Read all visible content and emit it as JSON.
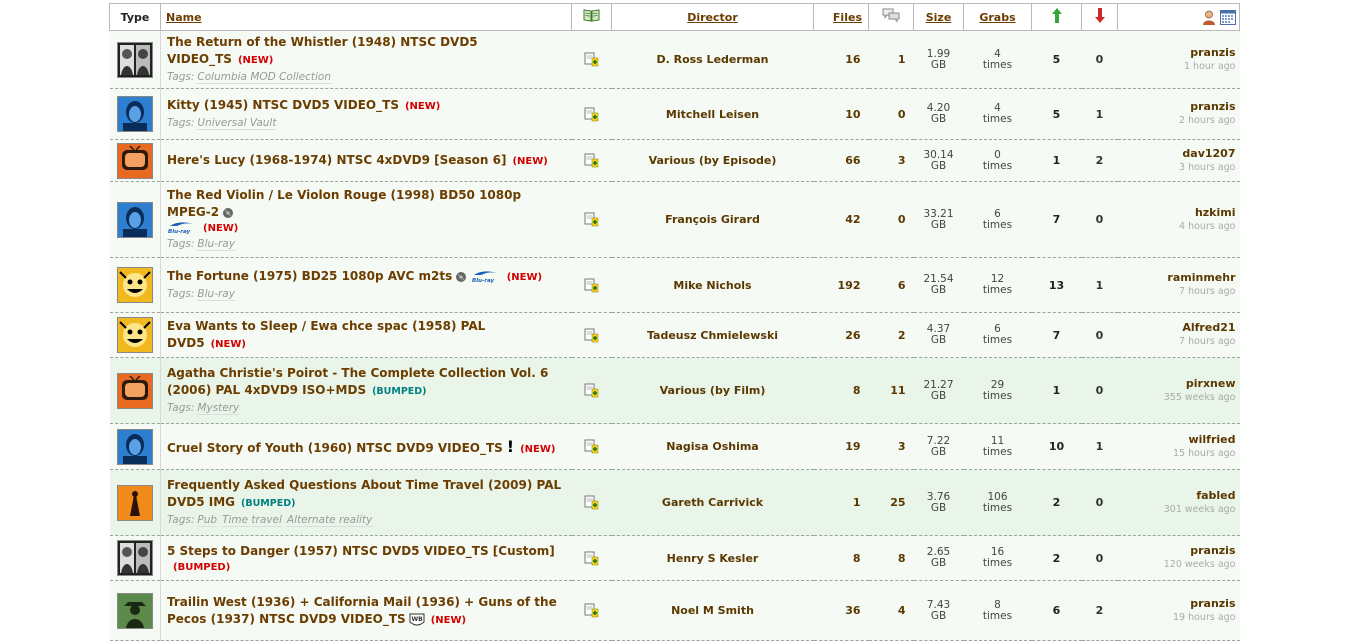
{
  "headers": {
    "type": "Type",
    "name": "Name",
    "director": "Director",
    "files": "Files",
    "size": "Size",
    "grabs": "Grabs"
  },
  "icons": {
    "book": "book-icon",
    "comments": "comments-icon",
    "seeders": "green-up-arrow-icon",
    "leechers": "red-down-arrow-icon",
    "uploader": "user-icon",
    "date": "calendar-icon",
    "add": "add-bookmark-icon"
  },
  "colors": {
    "link": "#6b3d00",
    "new": "#d40000",
    "bumped": "#008080",
    "row_bg": "#f5faf5",
    "bumped_row_bg": "#e9f5e9"
  },
  "rows": [
    {
      "title": "The Return of the Whistler (1948) NTSC DVD5 VIDEO_TS",
      "badge": "(NEW)",
      "tagsLabel": "Tags:",
      "tags": [
        "Columbia MOD Collection"
      ],
      "director": "D. Ross Lederman",
      "files": "16",
      "comments": "1",
      "size_num": "1.99",
      "size_unit": "GB",
      "grabs_num": "4",
      "grabs_unit": "times",
      "seeders": "5",
      "leechers": "0",
      "user": "pranzis",
      "time": "1 hour ago"
    },
    {
      "title": "Kitty (1945) NTSC DVD5 VIDEO_TS",
      "badge": "(NEW)",
      "tagsLabel": "Tags:",
      "tags": [
        "Universal Vault"
      ],
      "director": "Mitchell Leisen",
      "files": "10",
      "comments": "0",
      "size_num": "4.20",
      "size_unit": "GB",
      "grabs_num": "4",
      "grabs_unit": "times",
      "seeders": "5",
      "leechers": "1",
      "user": "pranzis",
      "time": "2 hours ago"
    },
    {
      "title": "Here's Lucy (1968-1974) NTSC 4xDVD9 [Season 6]",
      "badge": "(NEW)",
      "tagsLabel": "",
      "tags": [],
      "director": "Various (by Episode)",
      "files": "66",
      "comments": "3",
      "size_num": "30.14",
      "size_unit": "GB",
      "grabs_num": "0",
      "grabs_unit": "times",
      "seeders": "1",
      "leechers": "2",
      "user": "dav1207",
      "time": "3 hours ago"
    },
    {
      "title": "The Red Violin / Le Violon Rouge (1998) BD50 1080p MPEG-2",
      "badge": "(NEW)",
      "tagsLabel": "Tags:",
      "tags": [
        "Blu-ray"
      ],
      "director": "François Girard",
      "files": "42",
      "comments": "0",
      "size_num": "33.21",
      "size_unit": "GB",
      "grabs_num": "6",
      "grabs_unit": "times",
      "seeders": "7",
      "leechers": "0",
      "user": "hzkimi",
      "time": "4 hours ago"
    },
    {
      "title": "The Fortune (1975) BD25 1080p AVC m2ts",
      "badge": "(NEW)",
      "tagsLabel": "Tags:",
      "tags": [
        "Blu-ray"
      ],
      "director": "Mike Nichols",
      "files": "192",
      "comments": "6",
      "size_num": "21.54",
      "size_unit": "GB",
      "grabs_num": "12",
      "grabs_unit": "times",
      "seeders": "13",
      "leechers": "1",
      "user": "raminmehr",
      "time": "7 hours ago"
    },
    {
      "title": "Eva Wants to Sleep / Ewa chce spac (1958) PAL DVD5",
      "badge": "(NEW)",
      "tagsLabel": "",
      "tags": [],
      "director": "Tadeusz Chmielewski",
      "files": "26",
      "comments": "2",
      "size_num": "4.37",
      "size_unit": "GB",
      "grabs_num": "6",
      "grabs_unit": "times",
      "seeders": "7",
      "leechers": "0",
      "user": "Alfred21",
      "time": "7 hours ago"
    },
    {
      "title": "Agatha Christie's Poirot - The Complete Collection Vol. 6 (2006) PAL 4xDVD9 ISO+MDS",
      "badge": "(BUMPED)",
      "tagsLabel": "Tags:",
      "tags": [
        "Mystery"
      ],
      "director": "Various (by Film)",
      "files": "8",
      "comments": "11",
      "size_num": "21.27",
      "size_unit": "GB",
      "grabs_num": "29",
      "grabs_unit": "times",
      "seeders": "1",
      "leechers": "0",
      "user": "pirxnew",
      "time": "355 weeks ago"
    },
    {
      "title": "Cruel Story of Youth (1960) NTSC DVD9 VIDEO_TS",
      "badge": "(NEW)",
      "tagsLabel": "",
      "tags": [],
      "director": "Nagisa Oshima",
      "files": "19",
      "comments": "3",
      "size_num": "7.22",
      "size_unit": "GB",
      "grabs_num": "11",
      "grabs_unit": "times",
      "seeders": "10",
      "leechers": "1",
      "user": "wilfried",
      "time": "15 hours ago"
    },
    {
      "title": "Frequently Asked Questions About Time Travel (2009) PAL DVD5 IMG",
      "badge": "(BUMPED)",
      "tagsLabel": "Tags:",
      "tags": [
        "Pub",
        "Time travel",
        "Alternate reality"
      ],
      "director": "Gareth Carrivick",
      "files": "1",
      "comments": "25",
      "size_num": "3.76",
      "size_unit": "GB",
      "grabs_num": "106",
      "grabs_unit": "times",
      "seeders": "2",
      "leechers": "0",
      "user": "fabled",
      "time": "301 weeks ago"
    },
    {
      "title": "5 Steps to Danger (1957) NTSC DVD5 VIDEO_TS [Custom]",
      "badge": "(BUMPED)",
      "tagsLabel": "",
      "tags": [],
      "director": "Henry S Kesler",
      "files": "8",
      "comments": "8",
      "size_num": "2.65",
      "size_unit": "GB",
      "grabs_num": "16",
      "grabs_unit": "times",
      "seeders": "2",
      "leechers": "0",
      "user": "pranzis",
      "time": "120 weeks ago"
    },
    {
      "title": "Trailin West (1936) + California Mail (1936) + Guns of the Pecos (1937) NTSC DVD9 VIDEO_TS",
      "badge": "(NEW)",
      "tagsLabel": "",
      "tags": [],
      "director": "Noel M Smith",
      "files": "36",
      "comments": "4",
      "size_num": "7.43",
      "size_unit": "GB",
      "grabs_num": "8",
      "grabs_unit": "times",
      "seeders": "6",
      "leechers": "2",
      "user": "pranzis",
      "time": "19 hours ago"
    }
  ]
}
